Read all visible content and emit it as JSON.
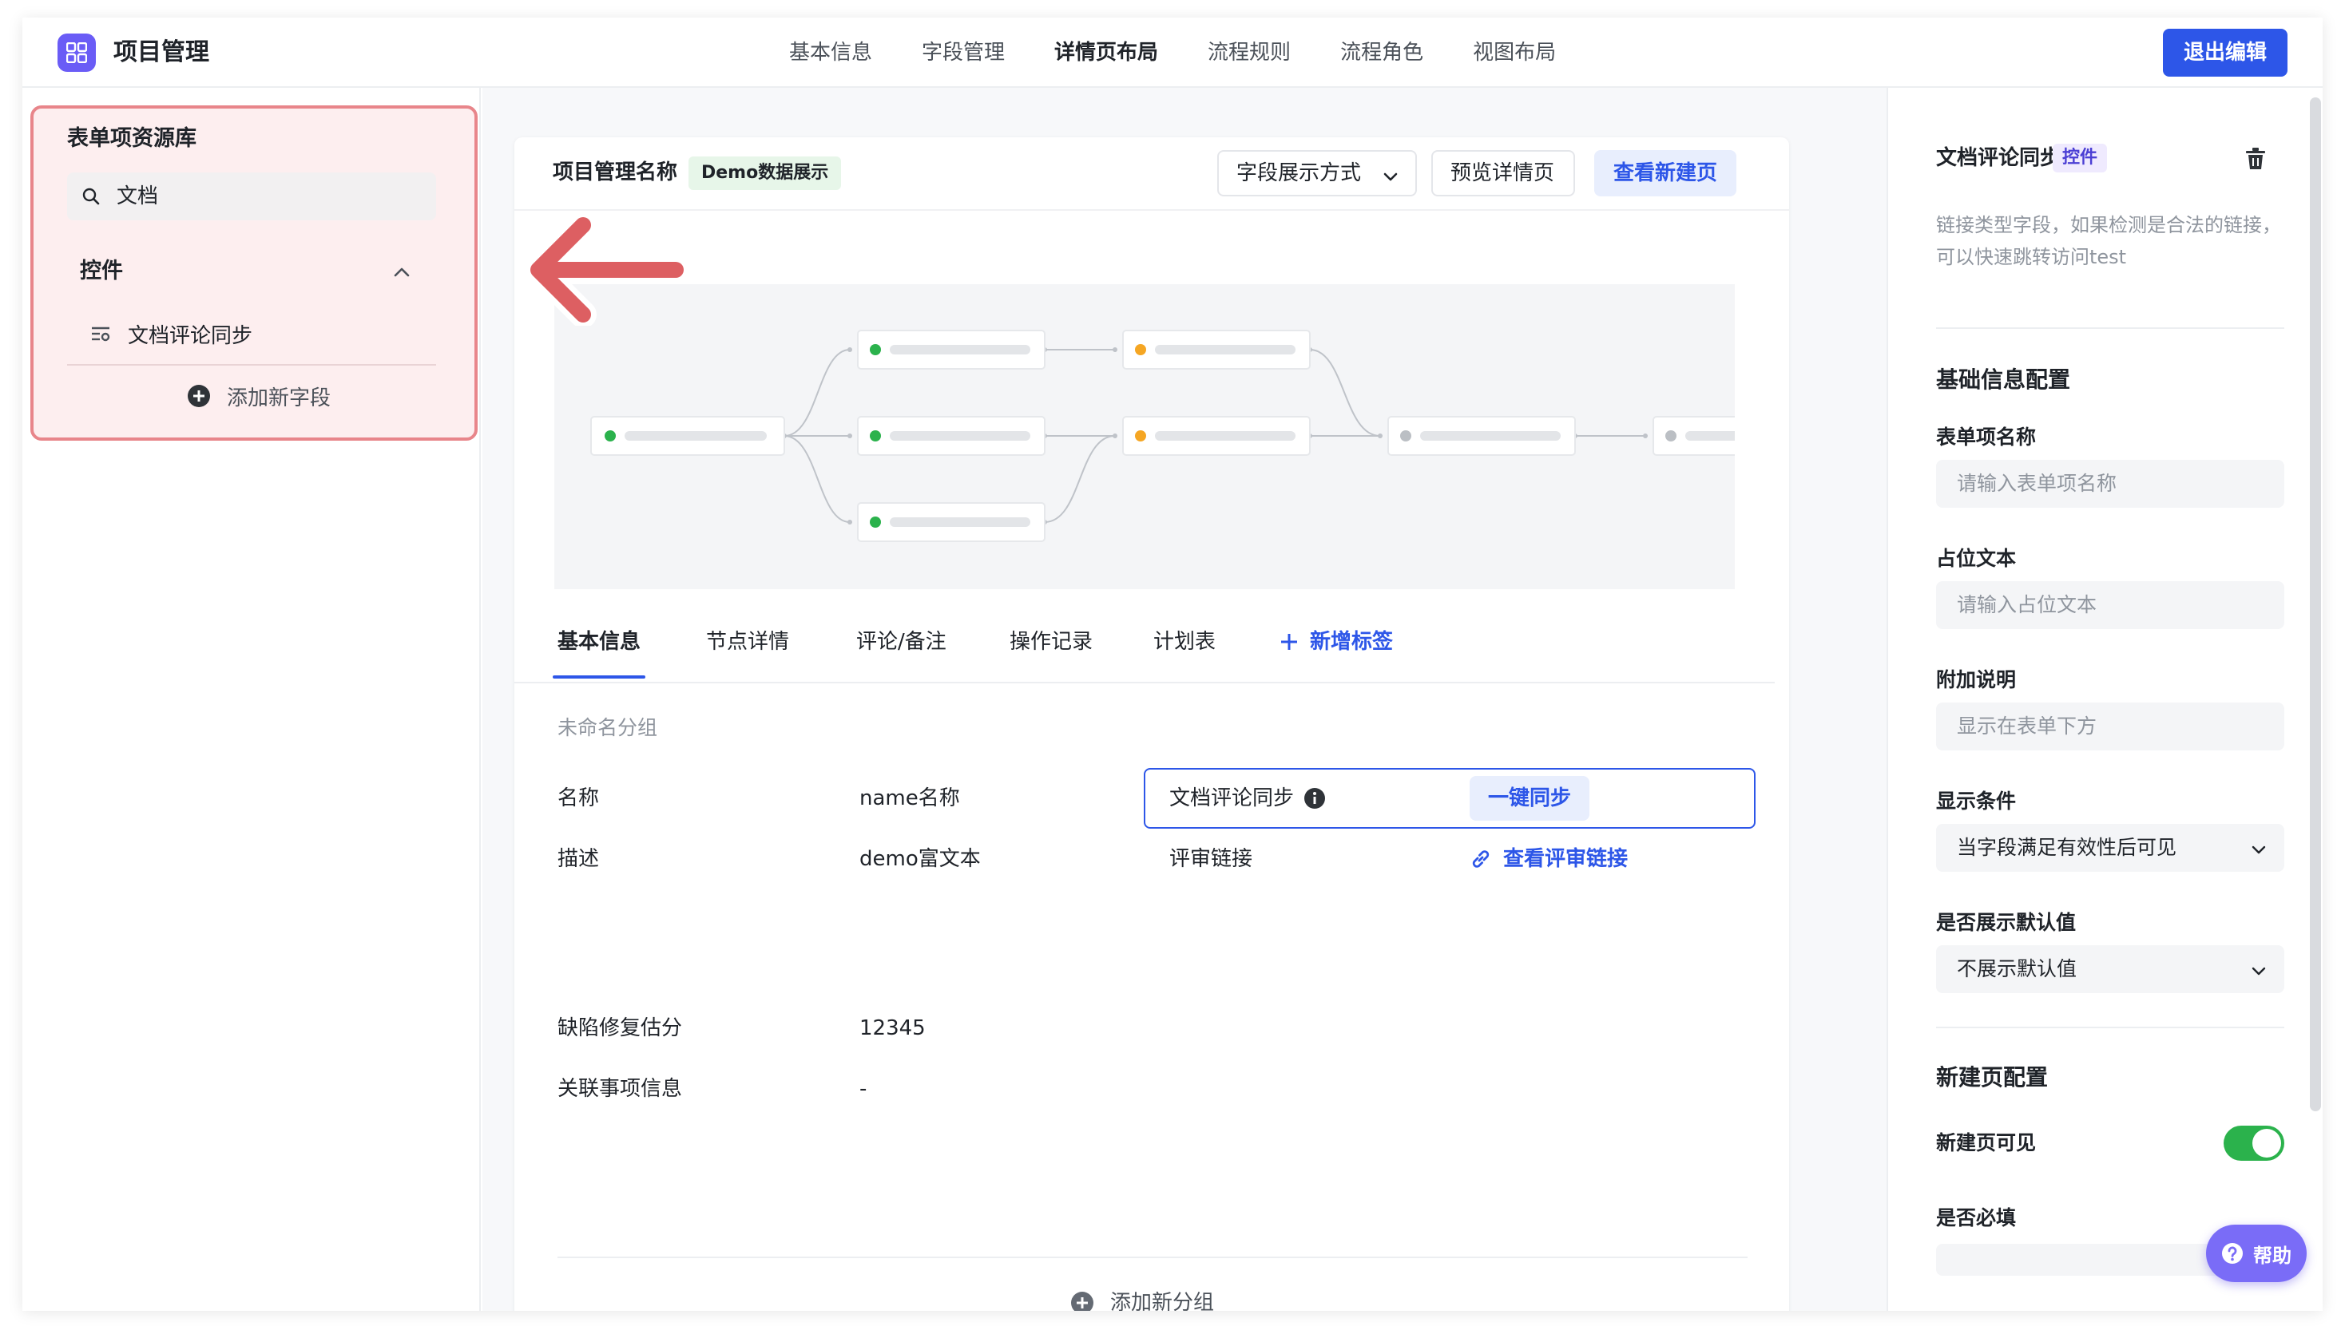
{
  "header": {
    "app_title": "项目管理",
    "nav": [
      "基本信息",
      "字段管理",
      "详情页布局",
      "流程规则",
      "流程角色",
      "视图布局"
    ],
    "active_nav": "详情页布局",
    "exit_label": "退出编辑"
  },
  "library": {
    "title": "表单项资源库",
    "search_value": "文档",
    "group_title": "控件",
    "items": [
      "文档评论同步"
    ],
    "add_field_label": "添加新字段"
  },
  "card": {
    "title": "项目管理名称",
    "tag": "Demo数据展示",
    "field_display_label": "字段展示方式",
    "preview_label": "预览详情页",
    "new_page_label": "查看新建页"
  },
  "tabs": {
    "items": [
      "基本信息",
      "节点详情",
      "评论/备注",
      "操作记录",
      "计划表"
    ],
    "add_label": "新增标签"
  },
  "fields": {
    "group_name": "未命名分组",
    "name_label": "名称",
    "name_value": "name名称",
    "desc_label": "描述",
    "desc_value": "demo富文本",
    "sync_label": "文档评论同步",
    "sync_button": "一键同步",
    "review_label": "评审链接",
    "review_link": "查看评审链接",
    "defect_label": "缺陷修复估分",
    "defect_value": "12345",
    "related_label": "关联事项信息",
    "related_value": "-",
    "add_group_label": "添加新分组"
  },
  "inspector": {
    "title": "文档评论同步",
    "tag": "控件",
    "description": "链接类型字段，如果检测是合法的链接，可以快速跳转访问test",
    "basic_section": "基础信息配置",
    "item_name_label": "表单项名称",
    "item_name_placeholder": "请输入表单项名称",
    "placeholder_label": "占位文本",
    "placeholder_placeholder": "请输入占位文本",
    "note_label": "附加说明",
    "note_placeholder": "显示在表单下方",
    "condition_label": "显示条件",
    "condition_value": "当字段满足有效性后可见",
    "default_label": "是否展示默认值",
    "default_value": "不展示默认值",
    "new_page_section": "新建页配置",
    "visible_label": "新建页可见",
    "visible_on": true,
    "required_label": "是否必填"
  },
  "help": {
    "label": "帮助"
  },
  "colors": {
    "primary": "#2d56e8",
    "highlight_border": "#e8858a",
    "highlight_fill": "#fdeeef",
    "toggle_on": "#2bb24c",
    "node_green": "#2bb24c",
    "node_orange": "#f5a623",
    "node_gray": "#bbbfc4"
  }
}
